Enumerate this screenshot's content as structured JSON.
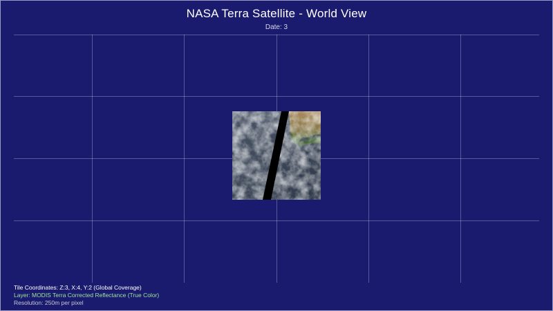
{
  "header": {
    "title": "NASA Terra Satellite - World View",
    "subtitle": "Date: 3"
  },
  "footer": {
    "tile_coordinates": "Tile Coordinates: Z:3, X:4, Y:2 (Global Coverage)",
    "layer": "Layer: MODIS Terra Corrected Reflectance (True Color)",
    "resolution": "Resolution: 250m per pixel"
  },
  "colors": {
    "background": "#1a1a6e",
    "layer_text": "#9fe59f"
  }
}
